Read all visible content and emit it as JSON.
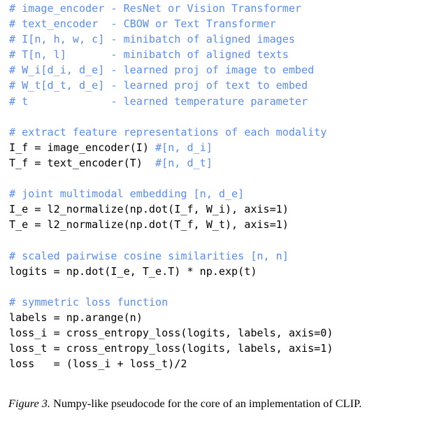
{
  "figure": {
    "kind": "code-listing-figure",
    "colors": {
      "comment": "#5a8cf0",
      "code": "#000000",
      "background": "#ffffff",
      "caption": "#000000"
    },
    "caption": {
      "label": "Figure 3.",
      "text": " Numpy-like pseudocode for the core of an implementation of CLIP."
    },
    "code": {
      "language": "numpy-like pseudocode",
      "lines": [
        {
          "index": 0,
          "type": "comment",
          "comment": "# image_encoder - ResNet or Vision Transformer"
        },
        {
          "index": 1,
          "type": "comment",
          "comment": "# text_encoder  - CBOW or Text Transformer"
        },
        {
          "index": 2,
          "type": "comment",
          "comment": "# I[n, h, w, c] - minibatch of aligned images"
        },
        {
          "index": 3,
          "type": "comment",
          "comment": "# T[n, l]       - minibatch of aligned texts"
        },
        {
          "index": 4,
          "type": "comment",
          "comment": "# W_i[d_i, d_e] - learned proj of image to embed"
        },
        {
          "index": 5,
          "type": "comment",
          "comment": "# W_t[d_t, d_e] - learned proj of text to embed"
        },
        {
          "index": 6,
          "type": "comment",
          "comment": "# t             - learned temperature parameter"
        },
        {
          "index": 7,
          "type": "blank",
          "code": "",
          "comment": ""
        },
        {
          "index": 8,
          "type": "comment",
          "comment": "# extract feature representations of each modality"
        },
        {
          "index": 9,
          "type": "code-with-comment",
          "code": "I_f = image_encoder(I) ",
          "comment": "#[n, d_i]"
        },
        {
          "index": 10,
          "type": "code-with-comment",
          "code": "T_f = text_encoder(T)  ",
          "comment": "#[n, d_t]"
        },
        {
          "index": 11,
          "type": "blank",
          "code": "",
          "comment": ""
        },
        {
          "index": 12,
          "type": "comment",
          "comment": "# joint multimodal embedding [n, d_e]"
        },
        {
          "index": 13,
          "type": "code",
          "code": "I_e = l2_normalize(np.dot(I_f, W_i), axis=1)"
        },
        {
          "index": 14,
          "type": "code",
          "code": "T_e = l2_normalize(np.dot(T_f, W_t), axis=1)"
        },
        {
          "index": 15,
          "type": "blank",
          "code": "",
          "comment": ""
        },
        {
          "index": 16,
          "type": "comment",
          "comment": "# scaled pairwise cosine similarities [n, n]"
        },
        {
          "index": 17,
          "type": "code",
          "code": "logits = np.dot(I_e, T_e.T) * np.exp(t)"
        },
        {
          "index": 18,
          "type": "blank",
          "code": "",
          "comment": ""
        },
        {
          "index": 19,
          "type": "comment",
          "comment": "# symmetric loss function"
        },
        {
          "index": 20,
          "type": "code",
          "code": "labels = np.arange(n)"
        },
        {
          "index": 21,
          "type": "code",
          "code": "loss_i = cross_entropy_loss(logits, labels, axis=0)"
        },
        {
          "index": 22,
          "type": "code",
          "code": "loss_t = cross_entropy_loss(logits, labels, axis=1)"
        },
        {
          "index": 23,
          "type": "code",
          "code": "loss   = (loss_i + loss_t)/2"
        }
      ]
    }
  }
}
